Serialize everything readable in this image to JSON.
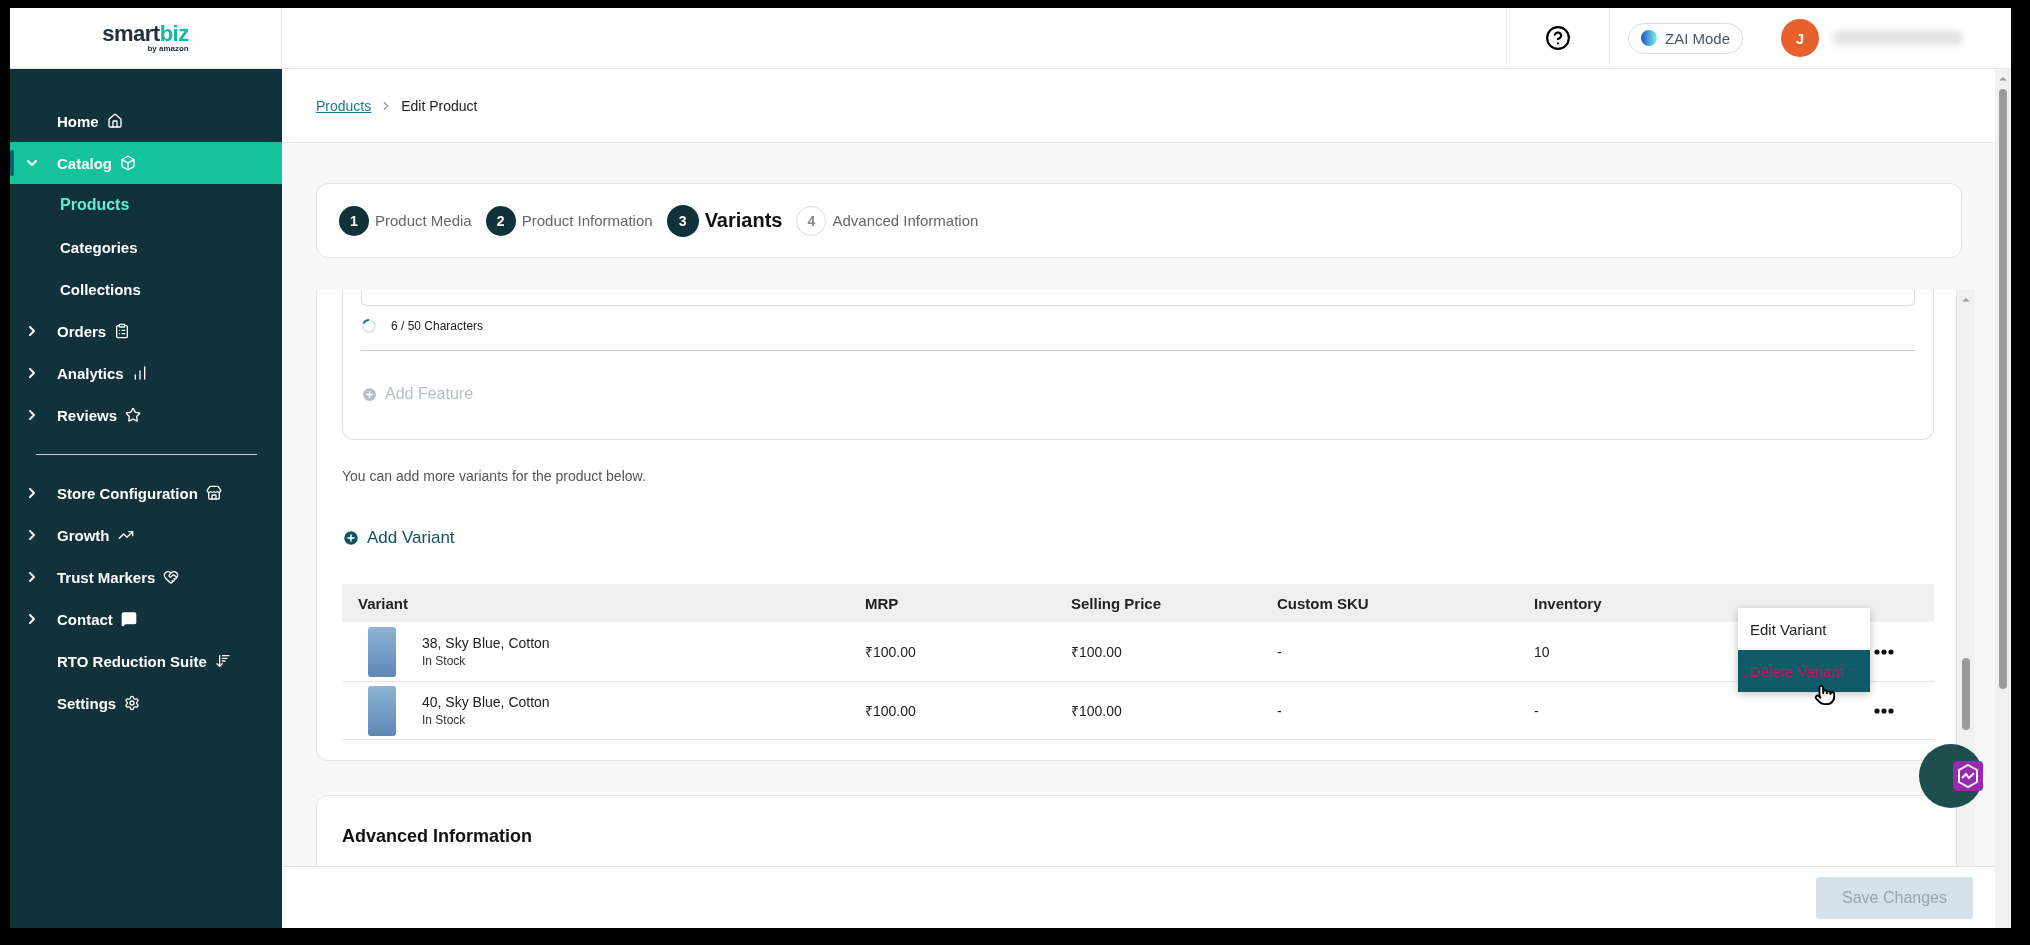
{
  "logo": {
    "primary": "smart",
    "accent": "biz",
    "tagline": "by amazon"
  },
  "top_bar": {
    "zai_mode": "ZAI Mode",
    "avatar_initial": "J"
  },
  "sidebar": {
    "sections": [
      {
        "items": [
          {
            "label": "Home",
            "kind": "link",
            "selected": false
          },
          {
            "label": "Catalog",
            "kind": "group",
            "expanded": true,
            "selected": true,
            "children": [
              {
                "label": "Products",
                "selected": true
              },
              {
                "label": "Categories",
                "selected": false
              },
              {
                "label": "Collections",
                "selected": false
              }
            ]
          },
          {
            "label": "Orders",
            "kind": "group",
            "expanded": false,
            "selected": false
          },
          {
            "label": "Analytics",
            "kind": "group",
            "expanded": false,
            "selected": false
          },
          {
            "label": "Reviews",
            "kind": "group",
            "expanded": false,
            "selected": false
          }
        ]
      },
      {
        "items": [
          {
            "label": "Store Configuration",
            "kind": "group",
            "expanded": false,
            "selected": false
          },
          {
            "label": "Growth",
            "kind": "group",
            "expanded": false,
            "selected": false
          },
          {
            "label": "Trust Markers",
            "kind": "group",
            "expanded": false,
            "selected": false
          },
          {
            "label": "Contact",
            "kind": "group",
            "expanded": false,
            "selected": false
          },
          {
            "label": "RTO Reduction Suite",
            "kind": "link",
            "selected": false
          },
          {
            "label": "Settings",
            "kind": "link",
            "selected": false
          }
        ]
      }
    ]
  },
  "breadcrumb": {
    "link": "Products",
    "current": "Edit Product"
  },
  "steps": [
    {
      "number": "1",
      "label": "Product Media",
      "completed": true,
      "selected": false
    },
    {
      "number": "2",
      "label": "Product Information",
      "completed": true,
      "selected": false
    },
    {
      "number": "3",
      "label": "Variants",
      "completed": false,
      "selected": true
    },
    {
      "number": "4",
      "label": "Advanced Information",
      "completed": false,
      "selected": false
    }
  ],
  "features": {
    "counter": "6 / 50 Characters",
    "add_feature": {
      "label": "Add Feature",
      "disabled": true
    }
  },
  "variants_note": "You can add more variants for the product below.",
  "add_variant": "Add Variant",
  "table": {
    "columns": [
      "Variant",
      "MRP",
      "Selling Price",
      "Custom SKU",
      "Inventory"
    ],
    "rows": [
      {
        "name": "38, Sky Blue, Cotton",
        "stock": "In Stock",
        "mrp": "₹100.00",
        "price": "₹100.00",
        "sku": "-",
        "inventory": "10",
        "menu_open": true
      },
      {
        "name": "40, Sky Blue, Cotton",
        "stock": "In Stock",
        "mrp": "₹100.00",
        "price": "₹100.00",
        "sku": "-",
        "inventory": "-",
        "menu_open": false
      }
    ]
  },
  "row_menu": [
    {
      "label": "Edit Variant",
      "selected": false
    },
    {
      "label": "Delete Variant",
      "selected": true
    }
  ],
  "advanced_heading": "Advanced Information",
  "save_button": {
    "label": "Save Changes",
    "disabled": true
  }
}
